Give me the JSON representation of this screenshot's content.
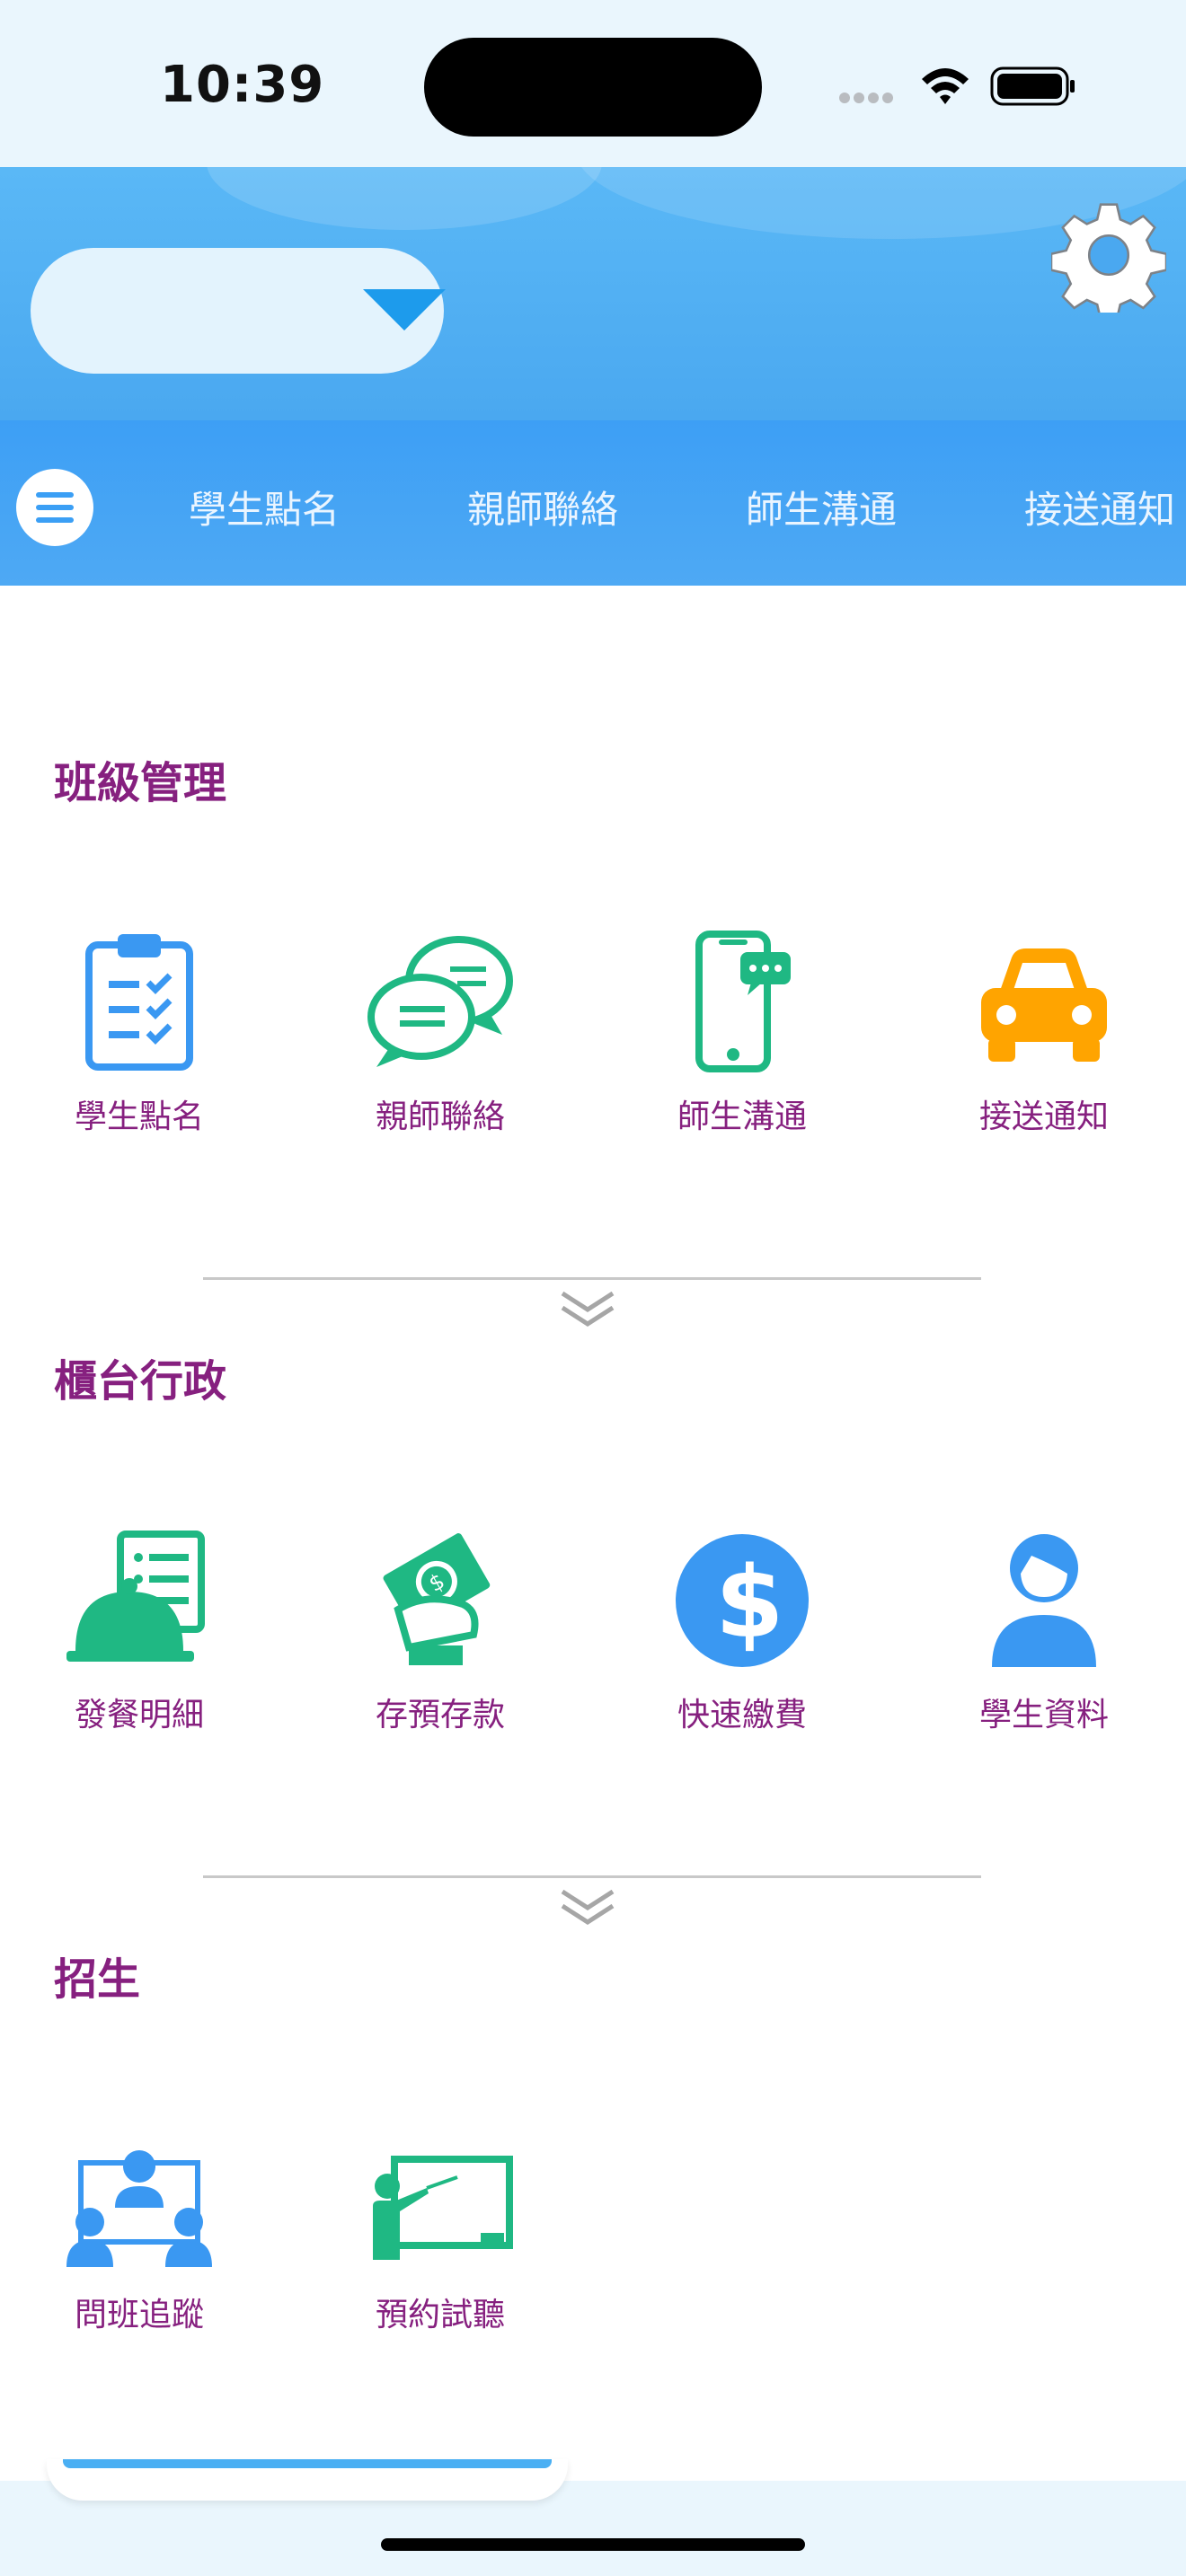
{
  "status_bar": {
    "time": "10:39"
  },
  "header": {
    "school_select_value": "",
    "settings_icon": "gear-icon"
  },
  "nav": {
    "tabs": [
      {
        "label": "學生點名"
      },
      {
        "label": "親師聯絡"
      },
      {
        "label": "師生溝通"
      },
      {
        "label": "接送通知"
      }
    ]
  },
  "sections": [
    {
      "title": "班級管理",
      "items": [
        {
          "label": "學生點名",
          "icon": "clipboard-check-icon"
        },
        {
          "label": "親師聯絡",
          "icon": "chat-bubbles-icon"
        },
        {
          "label": "師生溝通",
          "icon": "phone-message-icon"
        },
        {
          "label": "接送通知",
          "icon": "car-icon"
        }
      ]
    },
    {
      "title": "櫃台行政",
      "items": [
        {
          "label": "發餐明細",
          "icon": "meal-list-icon"
        },
        {
          "label": "存預存款",
          "icon": "money-hand-icon"
        },
        {
          "label": "快速繳費",
          "icon": "dollar-icon"
        },
        {
          "label": "學生資料",
          "icon": "student-icon"
        }
      ]
    },
    {
      "title": "招生",
      "items": [
        {
          "label": "問班追蹤",
          "icon": "group-tracking-icon"
        },
        {
          "label": "預約試聽",
          "icon": "teacher-board-icon"
        }
      ]
    }
  ],
  "colors": {
    "accent_blue": "#3b9ff5",
    "title_purple": "#86207f",
    "icon_green": "#1fb883",
    "icon_orange": "#ffa400"
  }
}
